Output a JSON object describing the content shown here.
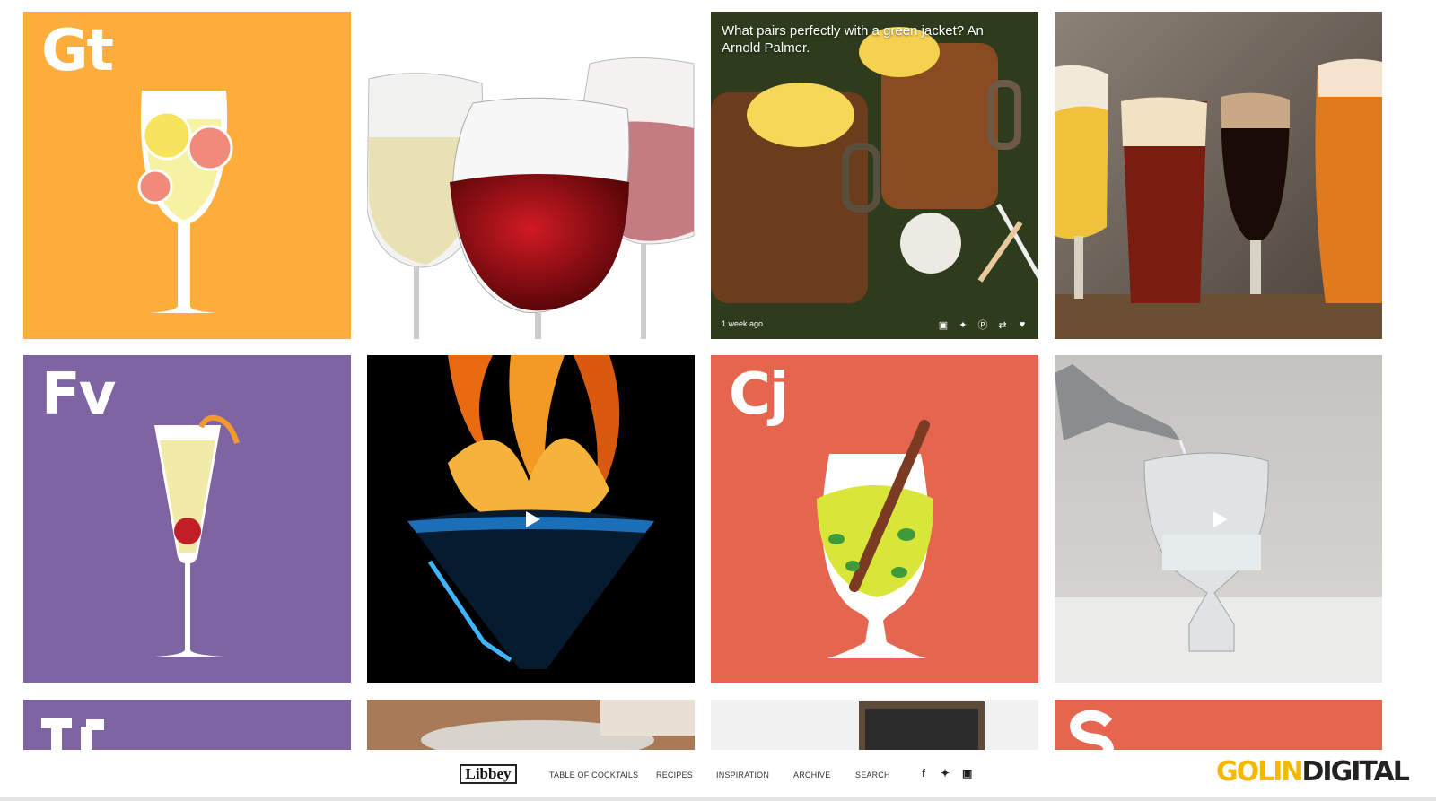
{
  "tiles": {
    "gt": {
      "letter": "Gt",
      "color": "#fcad3c"
    },
    "fv": {
      "letter": "Fv",
      "color": "#7e64a2"
    },
    "cj": {
      "letter": "Cj",
      "color": "#e6654f"
    },
    "tf": {
      "color": "#7e64a2"
    },
    "s": {
      "color": "#e6654f"
    },
    "arnold": {
      "caption": "What pairs perfectly with a green jacket? An Arnold Palmer.",
      "timestamp": "1 week ago",
      "share_icons": [
        "facebook-icon",
        "twitter-icon",
        "pinterest-icon",
        "reblog-icon",
        "heart-icon"
      ]
    },
    "fire": {
      "video": true
    },
    "pour": {
      "video": true
    }
  },
  "footer": {
    "logo": "Libbey",
    "nav": [
      "TABLE OF COCKTAILS",
      "RECIPES",
      "INSPIRATION",
      "ARCHIVE",
      "SEARCH"
    ],
    "social": [
      "f",
      "t",
      "ig"
    ],
    "brand_part1": "GOLIN",
    "brand_part2": "DIGITAL"
  }
}
